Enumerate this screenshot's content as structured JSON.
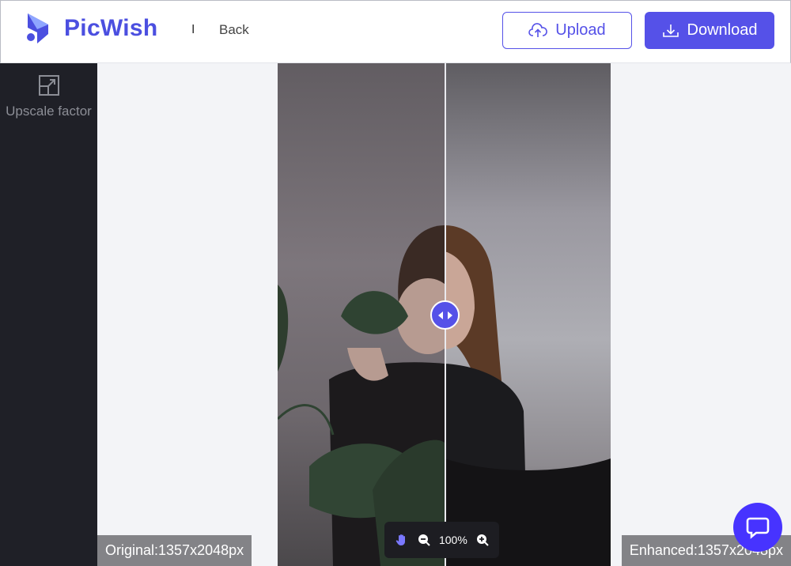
{
  "header": {
    "brand": "PicWish",
    "separator": "I",
    "back_label": "Back",
    "upload_label": "Upload",
    "download_label": "Download"
  },
  "sidebar": {
    "items": [
      {
        "label": "Upscale factor",
        "icon": "upscale-icon"
      }
    ]
  },
  "viewer": {
    "zoom": "100%",
    "original_label": "Original:1357x2048px",
    "enhanced_label": "Enhanced:1357x2048px"
  },
  "colors": {
    "accent": "#5551e8",
    "sidebar_bg": "#1f2027",
    "canvas_bg": "#f3f4f7",
    "chat_bg": "#4733ff"
  }
}
